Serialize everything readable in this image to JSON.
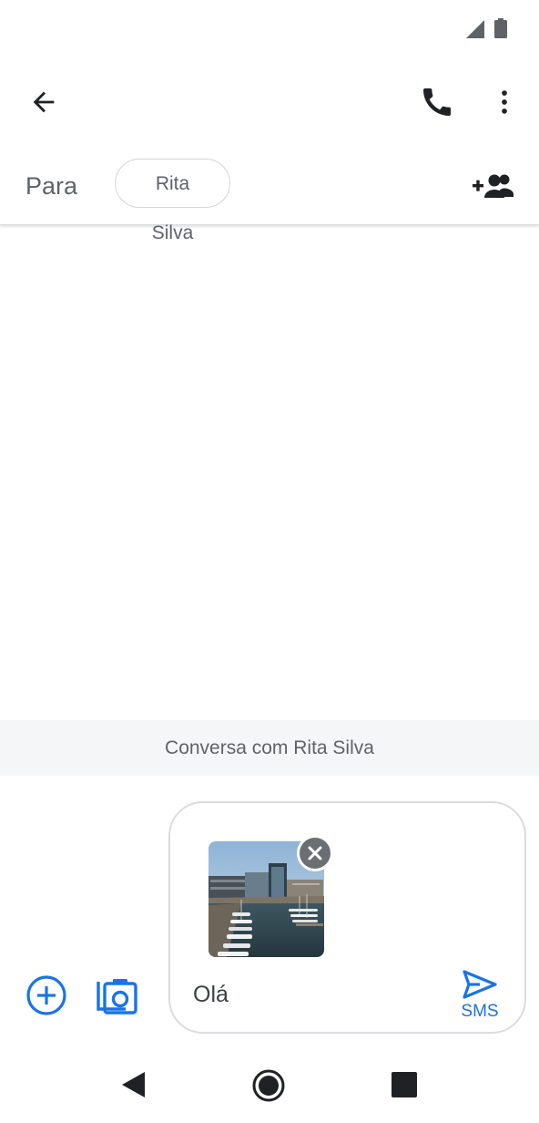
{
  "status_bar": {
    "icons": [
      "signal-icon",
      "battery-icon"
    ]
  },
  "app_bar": {
    "icons": [
      "back-arrow-icon",
      "phone-icon",
      "more-vert-icon"
    ]
  },
  "recipient_row": {
    "to_label": "Para",
    "recipient": "Rita Silva",
    "add_icon": "add-person-icon"
  },
  "conversation": {
    "banner": "Conversa com Rita Silva"
  },
  "compose": {
    "attachment_icon": "image-thumbnail",
    "remove_icon": "close-icon",
    "message": "Olá",
    "send_label": "SMS",
    "left_icons": [
      "add-circle-icon",
      "camera-icon"
    ]
  },
  "nav_bar": {
    "icons": [
      "nav-back-icon",
      "nav-home-icon",
      "nav-recents-icon"
    ]
  },
  "colors": {
    "accent": "#1a73e8",
    "icon_dark": "#202124",
    "chip_border": "#d2d5d9",
    "banner_bg": "#f5f6f7"
  }
}
